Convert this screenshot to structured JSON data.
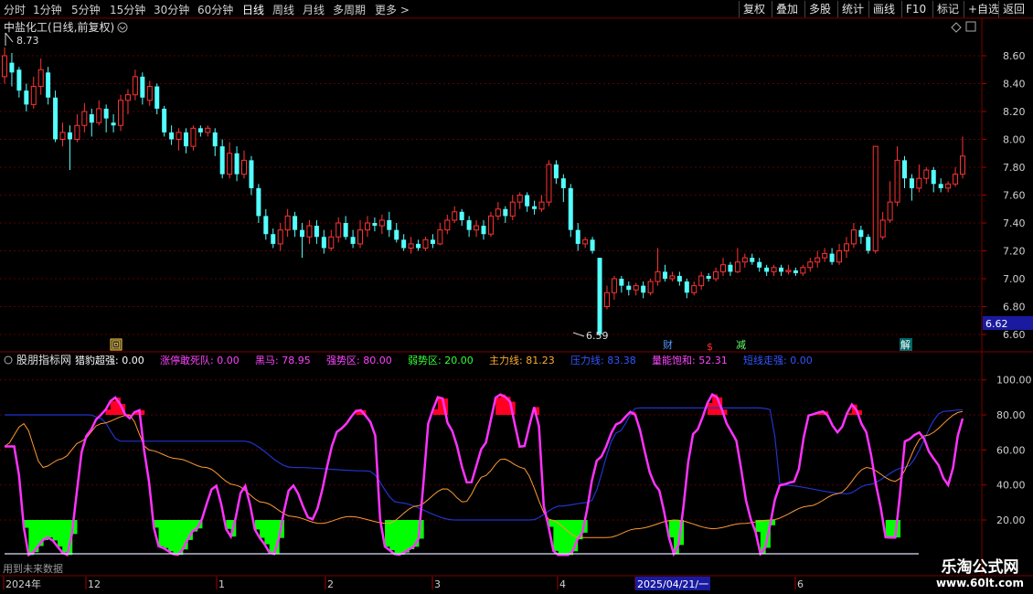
{
  "toolbar": {
    "periods": [
      "分时",
      "1分钟",
      "5分钟",
      "15分钟",
      "30分钟",
      "60分钟",
      "日线",
      "周线",
      "月线",
      "多周期",
      "更多 >"
    ],
    "active_period": "日线",
    "actions": [
      "复权",
      "叠加",
      "多股",
      "统计",
      "画线",
      "F10",
      "标记",
      "+自选",
      "返回"
    ]
  },
  "main_panel": {
    "title": "中盐化工(日线,前复权)",
    "price_axis": [
      "8.60",
      "8.40",
      "8.20",
      "8.00",
      "7.80",
      "7.60",
      "7.40",
      "7.20",
      "7.00",
      "6.80",
      "6.60"
    ],
    "high_label": "8.73",
    "low_label": "6.59",
    "current_price": "6.62",
    "event_markers": [
      "回",
      "财",
      "$",
      "减",
      "解"
    ]
  },
  "indicator_panel": {
    "name": "股朋指标网",
    "items": [
      {
        "label": "猎豹超强:",
        "value": "0.00",
        "color": "#ffffff"
      },
      {
        "label": "涨停敢死队:",
        "value": "0.00",
        "color": "#ff44ff"
      },
      {
        "label": "黑马:",
        "value": "78.95",
        "color": "#ff44ff"
      },
      {
        "label": "强势区:",
        "value": "80.00",
        "color": "#ff44ff"
      },
      {
        "label": "弱势区:",
        "value": "20.00",
        "color": "#33ff33"
      },
      {
        "label": "主力线:",
        "value": "81.23",
        "color": "#ffaa33"
      },
      {
        "label": "压力线:",
        "value": "83.38",
        "color": "#3355ff"
      },
      {
        "label": "量能饱和:",
        "value": "52.31",
        "color": "#ff44ff"
      },
      {
        "label": "短线走强:",
        "value": "0.00",
        "color": "#3355ff"
      }
    ],
    "axis": [
      "100.00",
      "80.00",
      "60.00",
      "40.00",
      "20.00"
    ]
  },
  "bottom_axis": {
    "labels": [
      "2024年",
      "12",
      "1",
      "2",
      "3",
      "4",
      "2025/04/21/一",
      "6"
    ],
    "note": "用到未来数据"
  },
  "watermark": {
    "line1": "乐淘公式网",
    "line2": "www.60lt.com"
  },
  "colors": {
    "up": "#ff3333",
    "down": "#54ffff",
    "grid": "#5a0000",
    "axis_text": "#d0d0d0",
    "magenta": "#ff33ff",
    "orange": "#ff9933",
    "blue": "#2233cc",
    "red_fill": "#ff0022",
    "green_fill": "#00ff00",
    "white_line": "#e0e0ff"
  },
  "chart_data": {
    "type": "candlestick",
    "price_range": [
      6.55,
      8.73
    ],
    "candles": [
      [
        8.45,
        8.6,
        8.66,
        8.4
      ],
      [
        8.55,
        8.48,
        8.62,
        8.38
      ],
      [
        8.5,
        8.35,
        8.52,
        8.3
      ],
      [
        8.35,
        8.25,
        8.4,
        8.2
      ],
      [
        8.25,
        8.38,
        8.45,
        8.22
      ],
      [
        8.38,
        8.5,
        8.58,
        8.32
      ],
      [
        8.48,
        8.3,
        8.52,
        8.25
      ],
      [
        8.3,
        8.0,
        8.35,
        7.98
      ],
      [
        8.0,
        8.05,
        8.12,
        7.95
      ],
      [
        8.05,
        8.0,
        8.1,
        7.78
      ],
      [
        8.0,
        8.1,
        8.18,
        7.98
      ],
      [
        8.1,
        8.2,
        8.26,
        8.05
      ],
      [
        8.18,
        8.12,
        8.22,
        8.02
      ],
      [
        8.12,
        8.22,
        8.28,
        8.1
      ],
      [
        8.22,
        8.15,
        8.25,
        8.05
      ],
      [
        8.12,
        8.1,
        8.18,
        8.05
      ],
      [
        8.1,
        8.28,
        8.32,
        8.06
      ],
      [
        8.28,
        8.32,
        8.36,
        8.18
      ],
      [
        8.32,
        8.45,
        8.5,
        8.28
      ],
      [
        8.45,
        8.3,
        8.48,
        8.25
      ],
      [
        8.28,
        8.38,
        8.42,
        8.24
      ],
      [
        8.38,
        8.22,
        8.4,
        8.18
      ],
      [
        8.22,
        8.05,
        8.24,
        8.02
      ],
      [
        8.05,
        8.0,
        8.1,
        7.96
      ],
      [
        8.0,
        8.05,
        8.08,
        7.92
      ],
      [
        8.05,
        7.95,
        8.08,
        7.9
      ],
      [
        7.95,
        8.08,
        8.1,
        7.92
      ],
      [
        8.08,
        8.05,
        8.1,
        8.02
      ],
      [
        8.05,
        8.08,
        8.1,
        8.02
      ],
      [
        8.05,
        7.95,
        8.08,
        7.88
      ],
      [
        7.95,
        7.75,
        8.0,
        7.72
      ],
      [
        7.75,
        7.9,
        7.98,
        7.72
      ],
      [
        7.9,
        7.75,
        7.95,
        7.7
      ],
      [
        7.75,
        7.85,
        7.92,
        7.72
      ],
      [
        7.85,
        7.65,
        7.88,
        7.6
      ],
      [
        7.65,
        7.45,
        7.68,
        7.4
      ],
      [
        7.45,
        7.32,
        7.5,
        7.28
      ],
      [
        7.32,
        7.25,
        7.36,
        7.22
      ],
      [
        7.25,
        7.35,
        7.4,
        7.2
      ],
      [
        7.35,
        7.45,
        7.5,
        7.3
      ],
      [
        7.45,
        7.35,
        7.48,
        7.3
      ],
      [
        7.35,
        7.3,
        7.4,
        7.15
      ],
      [
        7.3,
        7.38,
        7.42,
        7.25
      ],
      [
        7.38,
        7.3,
        7.42,
        7.25
      ],
      [
        7.3,
        7.22,
        7.35,
        7.18
      ],
      [
        7.22,
        7.3,
        7.35,
        7.2
      ],
      [
        7.3,
        7.4,
        7.44,
        7.26
      ],
      [
        7.4,
        7.3,
        7.45,
        7.28
      ],
      [
        7.3,
        7.25,
        7.35,
        7.22
      ],
      [
        7.25,
        7.35,
        7.42,
        7.22
      ],
      [
        7.35,
        7.4,
        7.45,
        7.3
      ],
      [
        7.4,
        7.38,
        7.44,
        7.34
      ],
      [
        7.38,
        7.42,
        7.46,
        7.32
      ],
      [
        7.42,
        7.35,
        7.48,
        7.3
      ],
      [
        7.35,
        7.28,
        7.4,
        7.26
      ],
      [
        7.28,
        7.22,
        7.32,
        7.2
      ],
      [
        7.22,
        7.25,
        7.3,
        7.18
      ],
      [
        7.25,
        7.22,
        7.28,
        7.2
      ],
      [
        7.22,
        7.28,
        7.3,
        7.2
      ],
      [
        7.28,
        7.25,
        7.32,
        7.22
      ],
      [
        7.25,
        7.35,
        7.4,
        7.24
      ],
      [
        7.35,
        7.42,
        7.46,
        7.32
      ],
      [
        7.42,
        7.48,
        7.52,
        7.4
      ],
      [
        7.48,
        7.42,
        7.5,
        7.38
      ],
      [
        7.42,
        7.35,
        7.45,
        7.3
      ],
      [
        7.35,
        7.38,
        7.42,
        7.3
      ],
      [
        7.38,
        7.32,
        7.42,
        7.28
      ],
      [
        7.32,
        7.45,
        7.48,
        7.3
      ],
      [
        7.45,
        7.5,
        7.55,
        7.42
      ],
      [
        7.5,
        7.45,
        7.52,
        7.4
      ],
      [
        7.45,
        7.55,
        7.6,
        7.42
      ],
      [
        7.55,
        7.6,
        7.62,
        7.5
      ],
      [
        7.6,
        7.52,
        7.62,
        7.48
      ],
      [
        7.52,
        7.5,
        7.56,
        7.46
      ],
      [
        7.5,
        7.55,
        7.6,
        7.48
      ],
      [
        7.55,
        7.82,
        7.85,
        7.52
      ],
      [
        7.82,
        7.72,
        7.85,
        7.68
      ],
      [
        7.72,
        7.65,
        7.75,
        7.55
      ],
      [
        7.65,
        7.35,
        7.68,
        7.3
      ],
      [
        7.35,
        7.25,
        7.4,
        7.2
      ],
      [
        7.25,
        7.28,
        7.3,
        7.22
      ],
      [
        7.28,
        7.2,
        7.3,
        7.18
      ],
      [
        7.15,
        6.6,
        7.15,
        6.59
      ],
      [
        6.8,
        6.9,
        6.95,
        6.78
      ],
      [
        6.9,
        7.0,
        7.02,
        6.85
      ],
      [
        7.0,
        6.95,
        7.02,
        6.9
      ],
      [
        6.95,
        6.92,
        6.98,
        6.88
      ],
      [
        6.92,
        6.95,
        6.97,
        6.88
      ],
      [
        6.95,
        6.9,
        6.98,
        6.86
      ],
      [
        6.9,
        6.98,
        7.0,
        6.88
      ],
      [
        6.98,
        7.05,
        7.22,
        6.95
      ],
      [
        7.05,
        7.0,
        7.1,
        6.98
      ],
      [
        7.0,
        7.02,
        7.05,
        6.98
      ],
      [
        7.02,
        6.98,
        7.05,
        6.95
      ],
      [
        6.98,
        6.9,
        7.0,
        6.86
      ],
      [
        6.9,
        6.95,
        6.98,
        6.88
      ],
      [
        6.95,
        7.02,
        7.05,
        6.92
      ],
      [
        7.02,
        7.0,
        7.04,
        6.98
      ],
      [
        7.0,
        7.05,
        7.08,
        6.98
      ],
      [
        7.05,
        7.1,
        7.15,
        7.02
      ],
      [
        7.1,
        7.05,
        7.12,
        7.02
      ],
      [
        7.05,
        7.12,
        7.22,
        7.04
      ],
      [
        7.12,
        7.15,
        7.18,
        7.08
      ],
      [
        7.15,
        7.12,
        7.18,
        7.1
      ],
      [
        7.12,
        7.08,
        7.15,
        7.05
      ],
      [
        7.08,
        7.05,
        7.1,
        7.02
      ],
      [
        7.05,
        7.08,
        7.1,
        7.02
      ],
      [
        7.08,
        7.05,
        7.1,
        7.02
      ],
      [
        7.05,
        7.06,
        7.1,
        7.03
      ],
      [
        7.06,
        7.04,
        7.08,
        7.02
      ],
      [
        7.04,
        7.08,
        7.1,
        7.02
      ],
      [
        7.08,
        7.12,
        7.15,
        7.05
      ],
      [
        7.12,
        7.15,
        7.2,
        7.08
      ],
      [
        7.15,
        7.18,
        7.22,
        7.12
      ],
      [
        7.18,
        7.12,
        7.22,
        7.1
      ],
      [
        7.12,
        7.2,
        7.25,
        7.1
      ],
      [
        7.2,
        7.25,
        7.3,
        7.15
      ],
      [
        7.25,
        7.35,
        7.4,
        7.22
      ],
      [
        7.35,
        7.3,
        7.38,
        7.25
      ],
      [
        7.3,
        7.2,
        7.32,
        7.18
      ],
      [
        7.2,
        7.95,
        7.95,
        7.18
      ],
      [
        7.3,
        7.42,
        7.48,
        7.28
      ],
      [
        7.42,
        7.55,
        7.7,
        7.4
      ],
      [
        7.55,
        7.85,
        7.95,
        7.52
      ],
      [
        7.85,
        7.72,
        7.88,
        7.65
      ],
      [
        7.72,
        7.65,
        7.75,
        7.56
      ],
      [
        7.65,
        7.72,
        7.82,
        7.62
      ],
      [
        7.72,
        7.78,
        7.8,
        7.68
      ],
      [
        7.78,
        7.68,
        7.8,
        7.62
      ],
      [
        7.68,
        7.65,
        7.72,
        7.62
      ],
      [
        7.65,
        7.68,
        7.7,
        7.62
      ],
      [
        7.68,
        7.75,
        7.8,
        7.66
      ],
      [
        7.75,
        7.88,
        8.02,
        7.72
      ]
    ]
  }
}
